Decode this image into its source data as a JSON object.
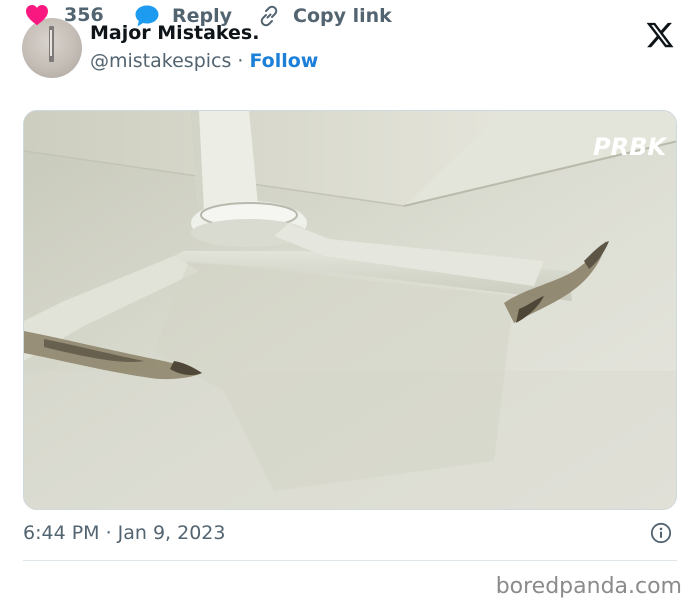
{
  "author": {
    "name": "Major Mistakes.",
    "handle": "@mistakespics",
    "separator": "·",
    "follow_label": "Follow"
  },
  "icons": {
    "logo": "x-logo-icon",
    "info": "info-icon",
    "like": "heart-icon",
    "reply": "speech-bubble-icon",
    "copy": "link-icon"
  },
  "media": {
    "watermark": "PRBK"
  },
  "meta": {
    "time": "6:44 PM",
    "separator": "·",
    "date": "Jan 9, 2023"
  },
  "actions": {
    "like_count": "356",
    "reply_label": "Reply",
    "copy_label": "Copy link"
  },
  "site_watermark": "boredpanda.com",
  "colors": {
    "follow": "#1d80d8",
    "heart": "#f91880",
    "reply_bubble": "#1d9bf0",
    "muted": "#536471"
  }
}
